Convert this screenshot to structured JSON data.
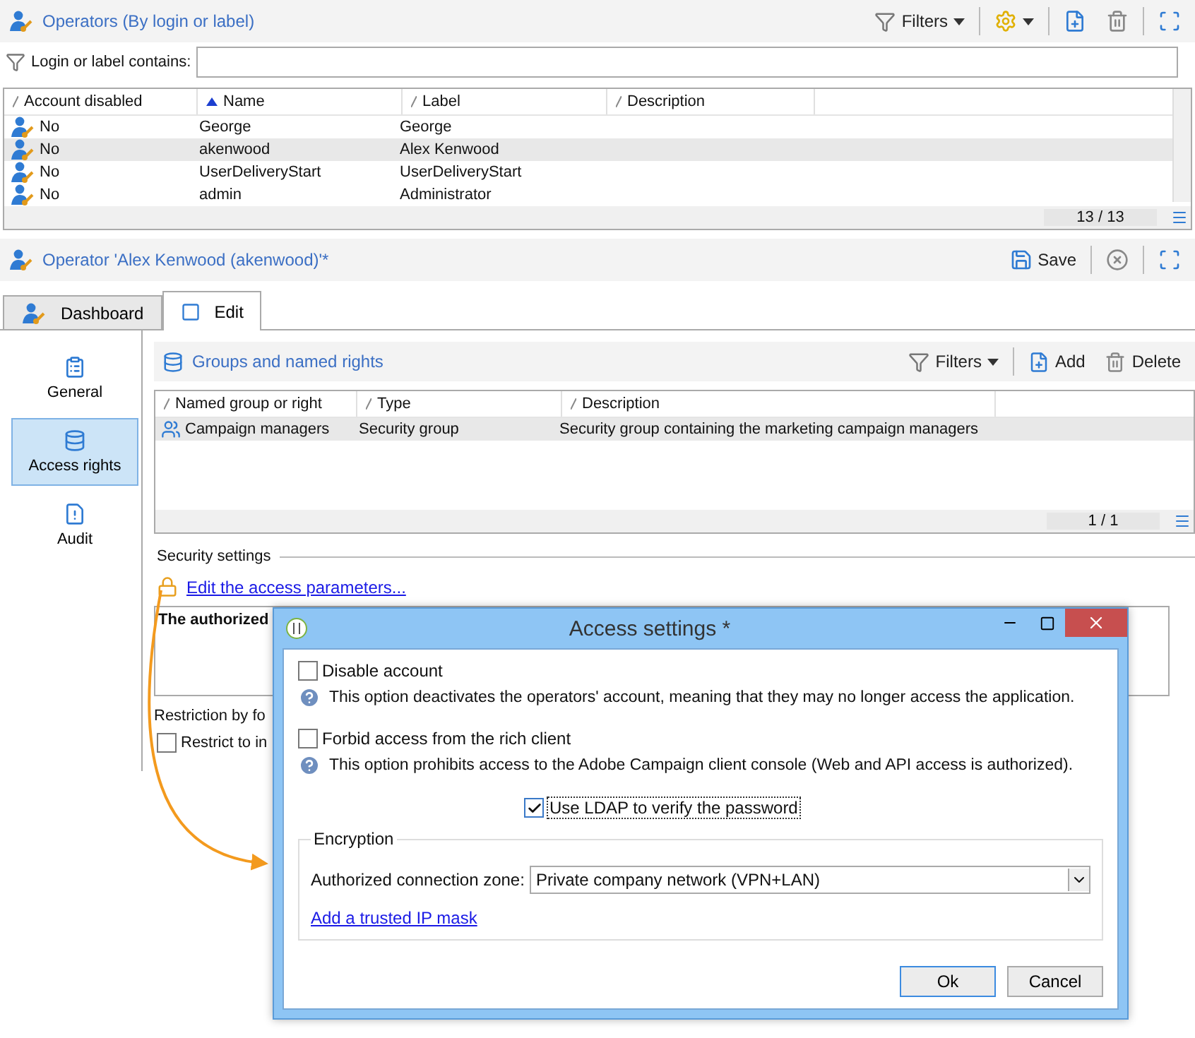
{
  "operators_panel": {
    "title": "Operators (By login or label)",
    "filters_button": "Filters",
    "filter_label": "Login or label contains:",
    "columns": [
      {
        "label": "Account disabled",
        "sorted": false
      },
      {
        "label": "Name",
        "sorted": true
      },
      {
        "label": "Label",
        "sorted": false
      },
      {
        "label": "Description",
        "sorted": false
      }
    ],
    "rows": [
      {
        "account_disabled": "No",
        "name": "George",
        "label": "George",
        "selected": false
      },
      {
        "account_disabled": "No",
        "name": "akenwood",
        "label": "Alex Kenwood",
        "selected": true
      },
      {
        "account_disabled": "No",
        "name": "UserDeliveryStart",
        "label": "UserDeliveryStart",
        "selected": false
      },
      {
        "account_disabled": "No",
        "name": "admin",
        "label": "Administrator",
        "selected": false
      }
    ],
    "count": "13 / 13"
  },
  "operator_panel": {
    "title": "Operator 'Alex Kenwood (akenwood)'*",
    "save_button": "Save",
    "tabs": [
      {
        "label": "Dashboard",
        "selected": false
      },
      {
        "label": "Edit",
        "selected": true
      }
    ],
    "sidebar": [
      {
        "label": "General",
        "selected": false
      },
      {
        "label": "Access rights",
        "selected": true
      },
      {
        "label": "Audit",
        "selected": false
      }
    ],
    "groups_title": "Groups and named rights",
    "filters_button": "Filters",
    "add_button": "Add",
    "delete_button": "Delete",
    "group_columns": [
      "Named group or right",
      "Type",
      "Description"
    ],
    "group_rows": [
      {
        "name": "Campaign managers",
        "type": "Security group",
        "description": "Security group containing the marketing campaign managers",
        "selected": true
      }
    ],
    "group_count": "1 / 1",
    "security_label": "Security settings",
    "access_link": "Edit the access parameters...",
    "summary": "The authorized",
    "restriction_label": "Restriction by fo",
    "restrict_checkbox": {
      "label": "Restrict to in",
      "checked": false
    }
  },
  "dialog": {
    "title": "Access settings *",
    "options": [
      {
        "label": "Disable account",
        "checked": false,
        "help": "This option deactivates the operators' account, meaning that they may no longer access the application."
      },
      {
        "label": "Forbid access from the rich client",
        "checked": false,
        "help": "This option prohibits access to the Adobe Campaign client console (Web and API access is authorized)."
      }
    ],
    "ldap": {
      "label": "Use LDAP to verify the password",
      "checked": true
    },
    "encryption_label": "Encryption",
    "zone_label": "Authorized connection zone:",
    "zone_value": "Private company network (VPN+LAN)",
    "ip_link": "Add a trusted IP mask",
    "buttons": [
      "Ok",
      "Cancel"
    ]
  }
}
